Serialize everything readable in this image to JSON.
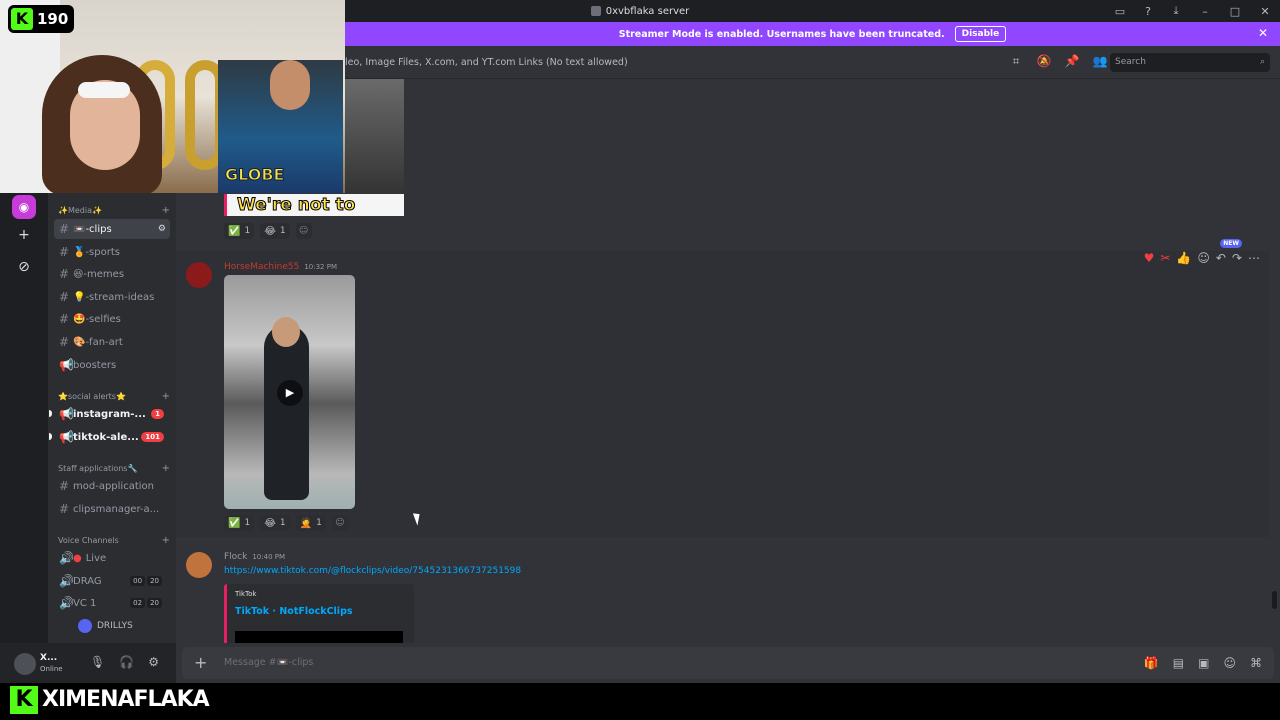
{
  "window": {
    "title": "0xvbflaka server"
  },
  "banner": {
    "text": "Streamer Mode is enabled. Usernames have been truncated.",
    "button": "Disable"
  },
  "header": {
    "topic": "leo, Image Files, X.com, and YT.com Links (No text allowed)",
    "search_placeholder": "Search"
  },
  "overlay": {
    "kick_count": "190",
    "kick_letter": "K",
    "footer_name": "XIMENAFLAKA",
    "webcam_sign": "GLOBE"
  },
  "sidebar": {
    "categories": {
      "media": "✨Media✨",
      "social": "⭐social alerts⭐",
      "staff": "Staff applications🔧",
      "voice": "Voice Channels"
    },
    "channels": {
      "clips": "📼-clips",
      "sports": "🏅-sports",
      "memes": "😆-memes",
      "stream_ideas": "💡-stream-ideas",
      "selfies": "🤩-selfies",
      "fan_art": "🎨-fan-art",
      "boosters": "boosters",
      "instagram": "instagram-...",
      "instagram_badge": "1",
      "tiktok": "tiktok-ale...",
      "tiktok_badge": "101",
      "mod_app": "mod-application",
      "clipsmanager": "clipsmanager-a...",
      "live": "Live",
      "drag": "DRAG",
      "drag_a": "00",
      "drag_b": "20",
      "vc1": "VC 1",
      "vc1_a": "02",
      "vc1_b": "20",
      "drillys": "DRILLYS"
    }
  },
  "user": {
    "name": "X...",
    "status": "Online"
  },
  "messages": {
    "image_caption": "We're not to",
    "reactions_top": [
      {
        "emoji": "✅",
        "count": "1"
      },
      {
        "emoji": "😂",
        "count": "1"
      }
    ],
    "msg2": {
      "author": "HorseMachine55",
      "time": "10:32 PM",
      "author_color": "#c8382f"
    },
    "reactions_mid": [
      {
        "emoji": "✅",
        "count": "1"
      },
      {
        "emoji": "😂",
        "count": "1"
      },
      {
        "emoji": "🤦",
        "count": "1"
      }
    ],
    "new_tag": "NEW",
    "msg3": {
      "author": "Flock",
      "time": "10:40 PM",
      "link": "https://www.tiktok.com/@flockclips/video/7545231366737251598",
      "embed_provider": "TikTok",
      "embed_title": "TikTok · NotFlockClips"
    }
  },
  "composer": {
    "placeholder": "Message #📼-clips"
  },
  "colors": {
    "accent": "#9147ff",
    "kick": "#53fc18",
    "link": "#00a8fc",
    "badge": "#f23f43"
  }
}
